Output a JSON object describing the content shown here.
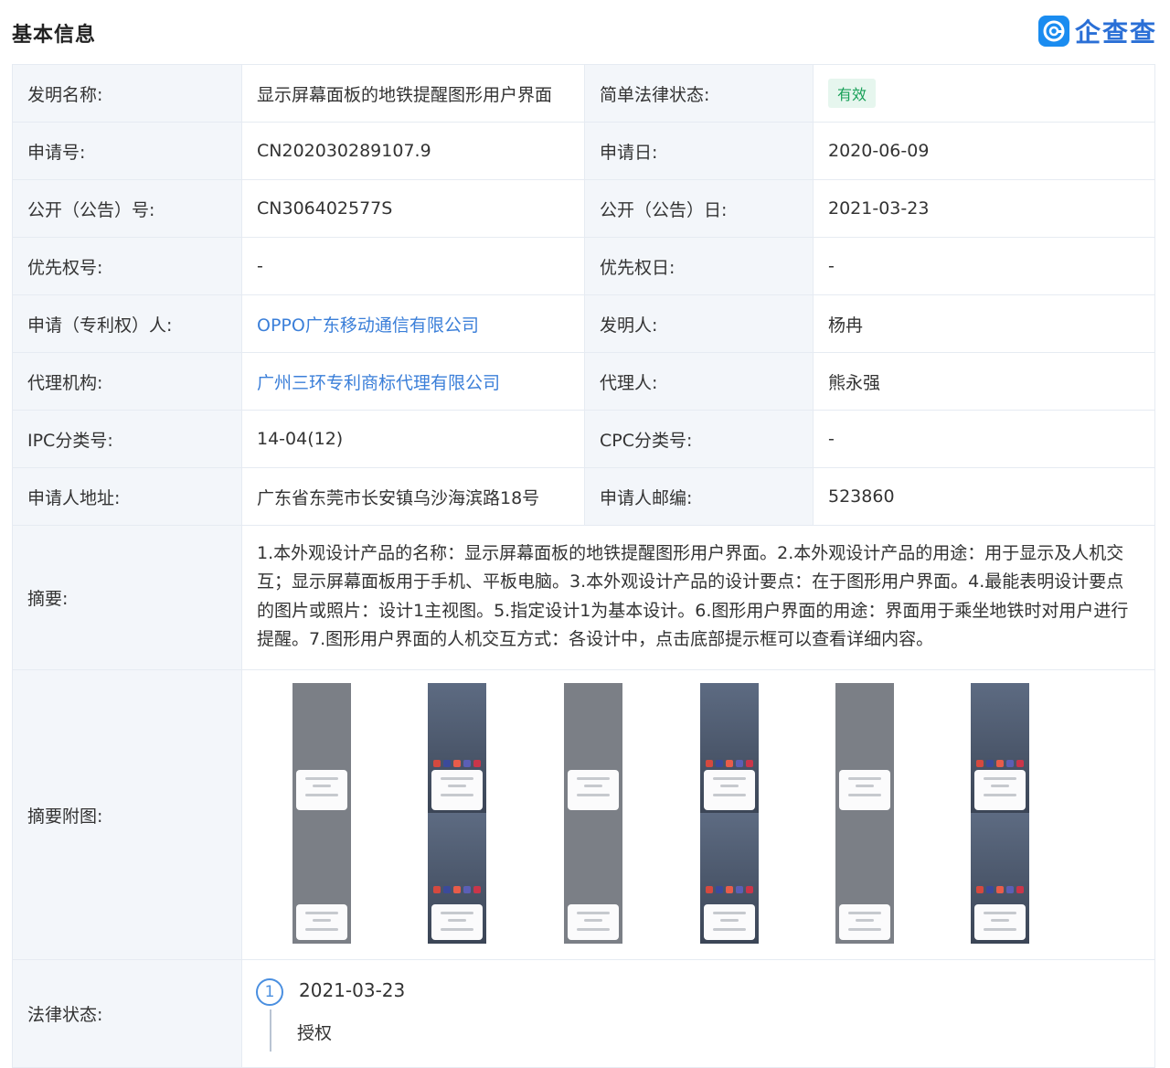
{
  "header": {
    "title": "基本信息",
    "brand": "企查查",
    "brand_icon": "qcc-logo-icon"
  },
  "rows": [
    {
      "l1": "发明名称:",
      "v1": "显示屏幕面板的地铁提醒图形用户界面",
      "l2": "简单法律状态:",
      "v2": "有效"
    },
    {
      "l1": "申请号:",
      "v1": "CN202030289107.9",
      "l2": "申请日:",
      "v2": "2020-06-09"
    },
    {
      "l1": "公开（公告）号:",
      "v1": "CN306402577S",
      "l2": "公开（公告）日:",
      "v2": "2021-03-23"
    },
    {
      "l1": "优先权号:",
      "v1": "-",
      "l2": "优先权日:",
      "v2": "-"
    },
    {
      "l1": "申请（专利权）人:",
      "v1": "OPPO广东移动通信有限公司",
      "l2": "发明人:",
      "v2": "杨冉"
    },
    {
      "l1": "代理机构:",
      "v1": "广州三环专利商标代理有限公司",
      "l2": "代理人:",
      "v2": "熊永强"
    },
    {
      "l1": "IPC分类号:",
      "v1": "14-04(12)",
      "l2": "CPC分类号:",
      "v2": "-"
    },
    {
      "l1": "申请人地址:",
      "v1": "广东省东莞市长安镇乌沙海滨路18号",
      "l2": "申请人邮编:",
      "v2": "523860"
    }
  ],
  "abstract": {
    "label": "摘要:",
    "text": "1.本外观设计产品的名称：显示屏幕面板的地铁提醒图形用户界面。2.本外观设计产品的用途：用于显示及人机交互；显示屏幕面板用于手机、平板电脑。3.本外观设计产品的设计要点：在于图形用户界面。4.最能表明设计要点的图片或照片：设计1主视图。5.指定设计1为基本设计。6.图形用户界面的用途：界面用于乘坐地铁时对用户进行提醒。7.图形用户界面的人机交互方式：各设计中，点击底部提示框可以查看详细内容。"
  },
  "figures": {
    "label": "摘要附图:"
  },
  "legal": {
    "label": "法律状态:",
    "step": "1",
    "date": "2021-03-23",
    "status": "授权"
  },
  "colors": {
    "link": "#3b7fd9",
    "badge_bg": "#e6f6ee",
    "badge_text": "#18a058",
    "label_bg": "#f3f6fa",
    "brand": "#2a6fd6"
  }
}
